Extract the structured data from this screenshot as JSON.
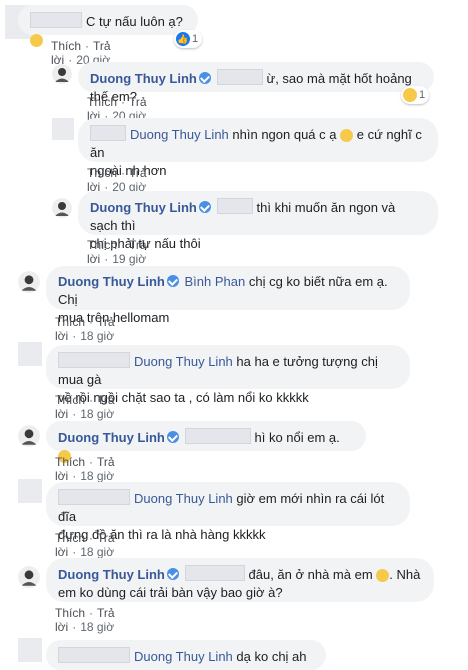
{
  "comments": [
    {
      "text": "C tự nấu luôn ạ?",
      "time": "20 giờ",
      "reaction_count": "1"
    },
    {
      "name": "Duong Thuy Linh",
      "text": "ừ, sao mà mặt hốt hoảng thế em?",
      "time": "20 giờ",
      "reaction_count": "1"
    },
    {
      "tag": "Duong Thuy Linh",
      "text_line1": "nhìn ngon quá c ạ",
      "text_line1b": "e cứ nghĩ c ăn",
      "text_line2": "ngoài nh hơn",
      "time": "20 giờ"
    },
    {
      "name": "Duong Thuy Linh",
      "text_line1": "thì khi muốn ăn ngon và sạch thì",
      "text_line2": "chị phải tự nấu thôi",
      "time": "19 giờ"
    },
    {
      "name": "Duong Thuy Linh",
      "tag": "Bình Phan",
      "text_line1": "chị cg ko biết nữa em ạ. Chị",
      "text_line2": "mua trên hellomam",
      "time": "18 giờ"
    },
    {
      "tag": "Duong Thuy Linh",
      "text_line1": "ha ha e tưởng tượng chị mua gà",
      "text_line2": "về rồi ngồi chặt sao ta , có làm nổi ko kkkkk",
      "time": "18 giờ"
    },
    {
      "name": "Duong Thuy Linh",
      "text": "hì ko nổi em ạ.",
      "time": "18 giờ"
    },
    {
      "tag": "Duong Thuy Linh",
      "text_line1": "giờ em mới nhìn ra cái lót đĩa",
      "text_line2": "đựng đồ ăn thì ra là nhà hàng kkkkk",
      "time": "18 giờ"
    },
    {
      "name": "Duong Thuy Linh",
      "text_line1": "đâu, ăn ở nhà mà em",
      "text_line1b": ". Nhà",
      "text_line2": "em ko dùng cái trải bàn vậy bao giờ à?",
      "time": "18 giờ"
    },
    {
      "tag": "Duong Thuy Linh",
      "text": "dạ ko chị ah"
    }
  ],
  "actions": {
    "like": "Thích",
    "reply": "Trả lời",
    "dot": "·"
  },
  "icons": {
    "verified": "verified-badge-icon",
    "wow": "wow-emoji-icon",
    "haha": "haha-emoji-icon",
    "like": "like-reaction-icon",
    "grin": "grin-emoji-icon"
  },
  "colors": {
    "link": "#385898",
    "bubble": "#f2f3f5",
    "meta": "#606770"
  }
}
